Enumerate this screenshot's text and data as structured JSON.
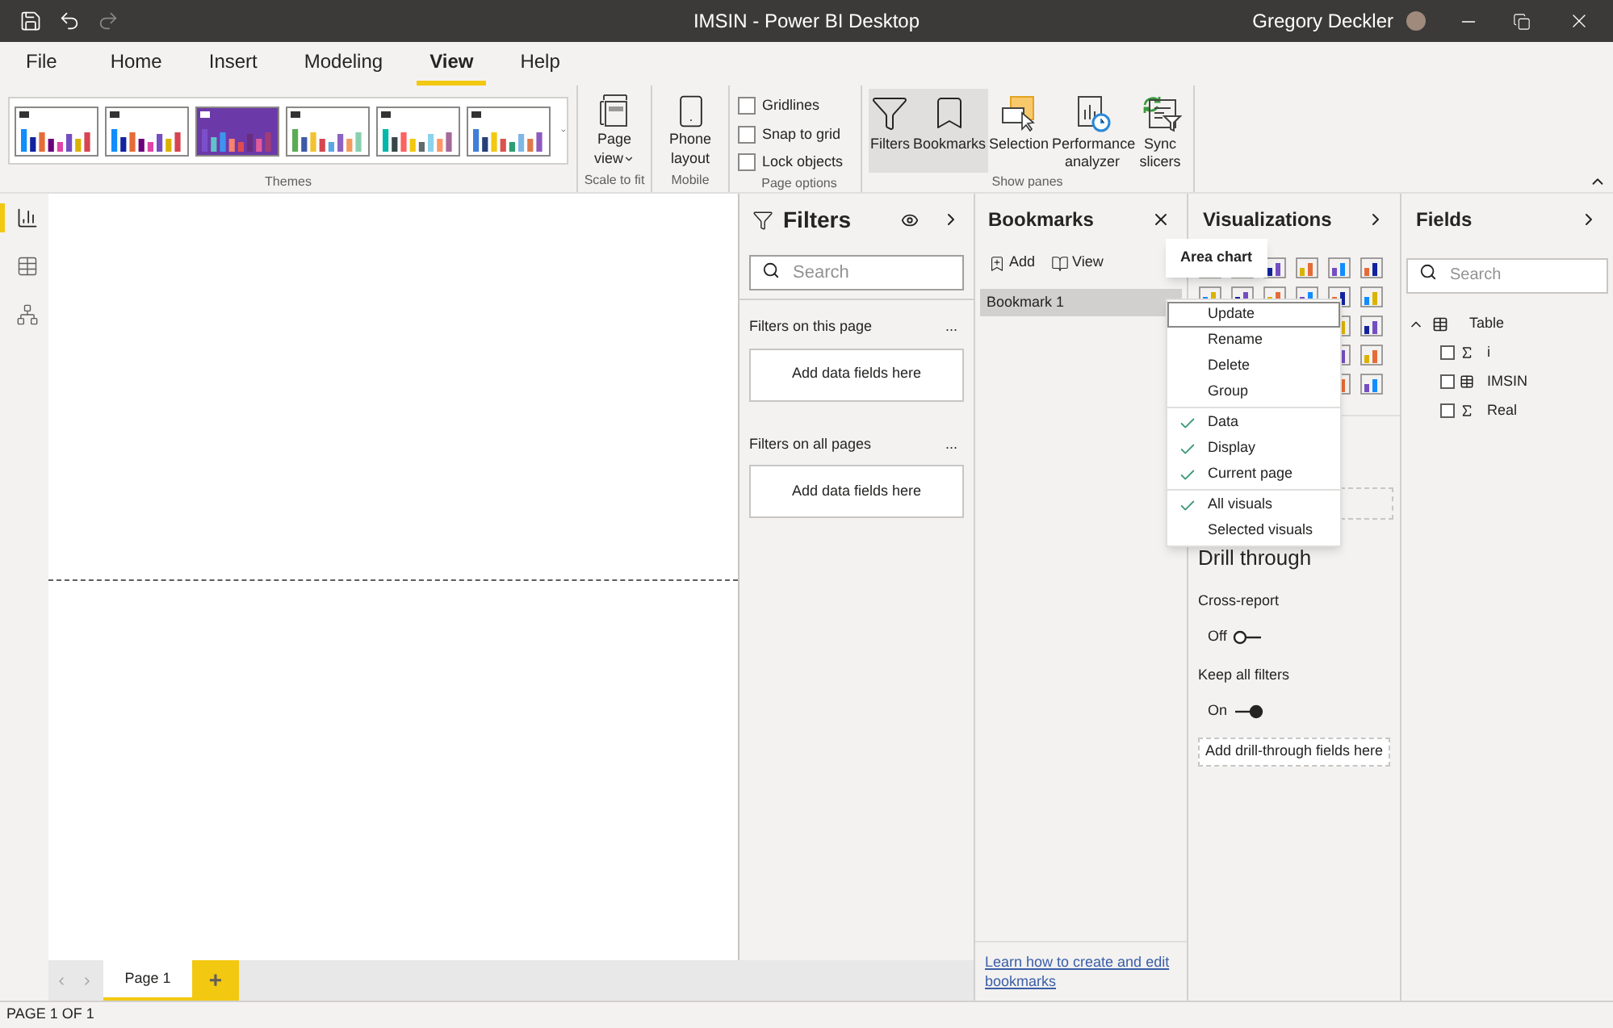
{
  "window": {
    "title": "IMSIN - Power BI Desktop",
    "user": "Gregory Deckler"
  },
  "menu_tabs": [
    {
      "label": "File",
      "selected": false
    },
    {
      "label": "Home",
      "selected": false
    },
    {
      "label": "Insert",
      "selected": false
    },
    {
      "label": "Modeling",
      "selected": false
    },
    {
      "label": "View",
      "selected": true
    },
    {
      "label": "Help",
      "selected": false
    }
  ],
  "ribbon": {
    "themes_label": "Themes",
    "page_view": "Page view",
    "scale_label": "Scale to fit",
    "phone_layout": "Phone layout",
    "mobile_label": "Mobile",
    "page_options_label": "Page options",
    "page_options": [
      {
        "label": "Gridlines",
        "checked": false
      },
      {
        "label": "Snap to grid",
        "checked": false
      },
      {
        "label": "Lock objects",
        "checked": false
      }
    ],
    "show_panes_label": "Show panes",
    "show_panes": [
      {
        "label": "Filters",
        "kind": "filters",
        "selected": true
      },
      {
        "label": "Bookmarks",
        "kind": "bookmarks",
        "selected": true
      },
      {
        "label": "Selection",
        "kind": "selection",
        "selected": false
      },
      {
        "label": "Performance analyzer",
        "kind": "performance",
        "selected": false
      },
      {
        "label": "Sync slicers",
        "kind": "sync",
        "selected": false
      }
    ]
  },
  "left_rail": [
    {
      "kind": "report",
      "selected": true
    },
    {
      "kind": "data",
      "selected": false
    },
    {
      "kind": "model",
      "selected": false
    }
  ],
  "page_tabs": [
    {
      "label": "Page 1",
      "selected": true
    }
  ],
  "add_page": "+",
  "filters": {
    "title": "Filters",
    "search_placeholder": "Search",
    "sections": [
      {
        "title": "Filters on this page",
        "menu": "...",
        "drop": "Add data fields here"
      },
      {
        "title": "Filters on all pages",
        "menu": "...",
        "drop": "Add data fields here"
      }
    ]
  },
  "bookmarks": {
    "title": "Bookmarks",
    "add": "Add",
    "view": "View",
    "items": [
      {
        "label": "Bookmark 1",
        "selected": true
      }
    ],
    "link": "Learn how to create and edit bookmarks"
  },
  "visualizations": {
    "title": "Visualizations",
    "drill_through": {
      "heading": "Drill through",
      "toggles": [
        {
          "label": "Cross-report",
          "state": "Off",
          "on": false
        },
        {
          "label": "Keep all filters",
          "state": "On",
          "on": true
        }
      ],
      "drop": "Add drill-through fields here"
    }
  },
  "fields": {
    "title": "Fields",
    "search_placeholder": "Search",
    "tables": [
      {
        "name": "Table",
        "expanded": true,
        "fields": [
          {
            "name": "i",
            "kind": "measure",
            "checked": false
          },
          {
            "name": "IMSIN",
            "kind": "table",
            "checked": false
          },
          {
            "name": "Real",
            "kind": "measure",
            "checked": false
          }
        ]
      }
    ]
  },
  "tooltip": "Area chart",
  "context_menu": {
    "groups": [
      [
        {
          "label": "Update",
          "selected": true
        },
        {
          "label": "Rename",
          "selected": false
        },
        {
          "label": "Delete",
          "selected": false
        },
        {
          "label": "Group",
          "selected": false
        }
      ],
      [
        {
          "label": "Data",
          "checked": true
        },
        {
          "label": "Display",
          "checked": true
        },
        {
          "label": "Current page",
          "checked": true
        }
      ],
      [
        {
          "label": "All visuals",
          "checked": true
        },
        {
          "label": "Selected visuals",
          "checked": false
        }
      ]
    ]
  },
  "status_bar": "PAGE 1 OF 1"
}
